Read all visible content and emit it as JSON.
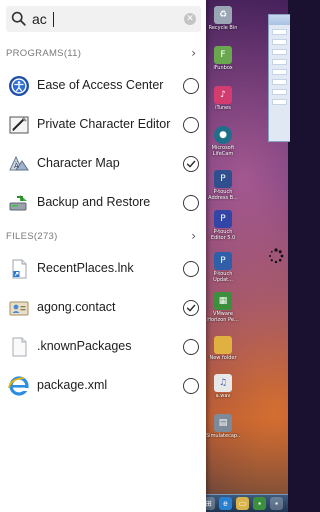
{
  "search": {
    "value": "ac"
  },
  "programs": {
    "header": "PROGRAMS(11)",
    "items": [
      {
        "label": "Ease of Access Center",
        "icon": "ease-of-access-icon",
        "checked": false
      },
      {
        "label": "Private Character Editor",
        "icon": "private-character-editor-icon",
        "checked": false
      },
      {
        "label": "Character Map",
        "icon": "character-map-icon",
        "checked": true
      },
      {
        "label": "Backup and Restore",
        "icon": "backup-restore-icon",
        "checked": false
      }
    ]
  },
  "files": {
    "header": "FILES(273)",
    "items": [
      {
        "label": "RecentPlaces.lnk",
        "icon": "shortcut-file-icon",
        "checked": false
      },
      {
        "label": "agong.contact",
        "icon": "contact-file-icon",
        "checked": true
      },
      {
        "label": ".knownPackages",
        "icon": "blank-file-icon",
        "checked": false
      },
      {
        "label": "package.xml",
        "icon": "ie-xml-file-icon",
        "checked": false
      }
    ]
  },
  "desktop_icons": [
    {
      "label": "Recycle Bin",
      "color": "#9aa6b4"
    },
    {
      "label": "iFunbox",
      "color": "#6aa84f"
    },
    {
      "label": "iTunes",
      "color": "#d23c6e"
    },
    {
      "label": "Microsoft LifeCam",
      "color": "#1f6f8b"
    },
    {
      "label": "P-touch Address B...",
      "color": "#2f4f8f"
    },
    {
      "label": "P-touch Editor 5.0",
      "color": "#3346a8"
    },
    {
      "label": "P-touch Updat...",
      "color": "#2f5fa8"
    },
    {
      "label": "VMware Horizon Pe...",
      "color": "#3c8f3c"
    },
    {
      "label": "New folder",
      "color": "#e0b040"
    },
    {
      "label": "a.wav",
      "color": "#e8e8e8"
    },
    {
      "label": "Simulatecap...",
      "color": "#7d8a99"
    }
  ],
  "colors": {
    "accent": "#1e1e1e",
    "panel": "#ffffff",
    "section_text": "#7a7a7a"
  }
}
